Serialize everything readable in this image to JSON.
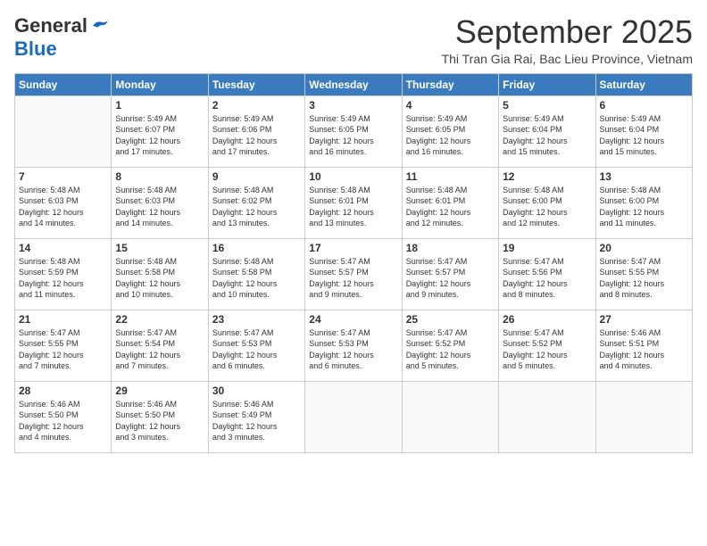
{
  "header": {
    "logo_general": "General",
    "logo_blue": "Blue",
    "month_title": "September 2025",
    "location": "Thi Tran Gia Rai, Bac Lieu Province, Vietnam"
  },
  "days_of_week": [
    "Sunday",
    "Monday",
    "Tuesday",
    "Wednesday",
    "Thursday",
    "Friday",
    "Saturday"
  ],
  "weeks": [
    [
      {
        "day": "",
        "info": ""
      },
      {
        "day": "1",
        "info": "Sunrise: 5:49 AM\nSunset: 6:07 PM\nDaylight: 12 hours\nand 17 minutes."
      },
      {
        "day": "2",
        "info": "Sunrise: 5:49 AM\nSunset: 6:06 PM\nDaylight: 12 hours\nand 17 minutes."
      },
      {
        "day": "3",
        "info": "Sunrise: 5:49 AM\nSunset: 6:05 PM\nDaylight: 12 hours\nand 16 minutes."
      },
      {
        "day": "4",
        "info": "Sunrise: 5:49 AM\nSunset: 6:05 PM\nDaylight: 12 hours\nand 16 minutes."
      },
      {
        "day": "5",
        "info": "Sunrise: 5:49 AM\nSunset: 6:04 PM\nDaylight: 12 hours\nand 15 minutes."
      },
      {
        "day": "6",
        "info": "Sunrise: 5:49 AM\nSunset: 6:04 PM\nDaylight: 12 hours\nand 15 minutes."
      }
    ],
    [
      {
        "day": "7",
        "info": ""
      },
      {
        "day": "8",
        "info": "Sunrise: 5:48 AM\nSunset: 6:03 PM\nDaylight: 12 hours\nand 14 minutes."
      },
      {
        "day": "9",
        "info": "Sunrise: 5:48 AM\nSunset: 6:02 PM\nDaylight: 12 hours\nand 13 minutes."
      },
      {
        "day": "10",
        "info": "Sunrise: 5:48 AM\nSunset: 6:01 PM\nDaylight: 12 hours\nand 13 minutes."
      },
      {
        "day": "11",
        "info": "Sunrise: 5:48 AM\nSunset: 6:01 PM\nDaylight: 12 hours\nand 12 minutes."
      },
      {
        "day": "12",
        "info": "Sunrise: 5:48 AM\nSunset: 6:00 PM\nDaylight: 12 hours\nand 12 minutes."
      },
      {
        "day": "13",
        "info": "Sunrise: 5:48 AM\nSunset: 6:00 PM\nDaylight: 12 hours\nand 11 minutes."
      }
    ],
    [
      {
        "day": "14",
        "info": ""
      },
      {
        "day": "15",
        "info": "Sunrise: 5:48 AM\nSunset: 5:58 PM\nDaylight: 12 hours\nand 10 minutes."
      },
      {
        "day": "16",
        "info": "Sunrise: 5:48 AM\nSunset: 5:58 PM\nDaylight: 12 hours\nand 10 minutes."
      },
      {
        "day": "17",
        "info": "Sunrise: 5:47 AM\nSunset: 5:57 PM\nDaylight: 12 hours\nand 9 minutes."
      },
      {
        "day": "18",
        "info": "Sunrise: 5:47 AM\nSunset: 5:57 PM\nDaylight: 12 hours\nand 9 minutes."
      },
      {
        "day": "19",
        "info": "Sunrise: 5:47 AM\nSunset: 5:56 PM\nDaylight: 12 hours\nand 8 minutes."
      },
      {
        "day": "20",
        "info": "Sunrise: 5:47 AM\nSunset: 5:55 PM\nDaylight: 12 hours\nand 8 minutes."
      }
    ],
    [
      {
        "day": "21",
        "info": ""
      },
      {
        "day": "22",
        "info": "Sunrise: 5:47 AM\nSunset: 5:54 PM\nDaylight: 12 hours\nand 7 minutes."
      },
      {
        "day": "23",
        "info": "Sunrise: 5:47 AM\nSunset: 5:53 PM\nDaylight: 12 hours\nand 6 minutes."
      },
      {
        "day": "24",
        "info": "Sunrise: 5:47 AM\nSunset: 5:53 PM\nDaylight: 12 hours\nand 6 minutes."
      },
      {
        "day": "25",
        "info": "Sunrise: 5:47 AM\nSunset: 5:52 PM\nDaylight: 12 hours\nand 5 minutes."
      },
      {
        "day": "26",
        "info": "Sunrise: 5:47 AM\nSunset: 5:52 PM\nDaylight: 12 hours\nand 5 minutes."
      },
      {
        "day": "27",
        "info": "Sunrise: 5:46 AM\nSunset: 5:51 PM\nDaylight: 12 hours\nand 4 minutes."
      }
    ],
    [
      {
        "day": "28",
        "info": "Sunrise: 5:46 AM\nSunset: 5:50 PM\nDaylight: 12 hours\nand 4 minutes."
      },
      {
        "day": "29",
        "info": "Sunrise: 5:46 AM\nSunset: 5:50 PM\nDaylight: 12 hours\nand 3 minutes."
      },
      {
        "day": "30",
        "info": "Sunrise: 5:46 AM\nSunset: 5:49 PM\nDaylight: 12 hours\nand 3 minutes."
      },
      {
        "day": "",
        "info": ""
      },
      {
        "day": "",
        "info": ""
      },
      {
        "day": "",
        "info": ""
      },
      {
        "day": "",
        "info": ""
      }
    ]
  ],
  "week1_sunday_info": "Sunrise: 5:48 AM\nSunset: 6:03 PM\nDaylight: 12 hours\nand 14 minutes.",
  "week2_sunday_info": "Sunrise: 5:48 AM\nSunset: 5:59 PM\nDaylight: 12 hours\nand 11 minutes.",
  "week3_sunday_info": "Sunrise: 5:47 AM\nSunset: 5:55 PM\nDaylight: 12 hours\nand 7 minutes.",
  "week4_sunday_info": "Sunrise: 5:47 AM\nSunset: 5:55 PM\nDaylight: 12 hours\nand 7 minutes."
}
